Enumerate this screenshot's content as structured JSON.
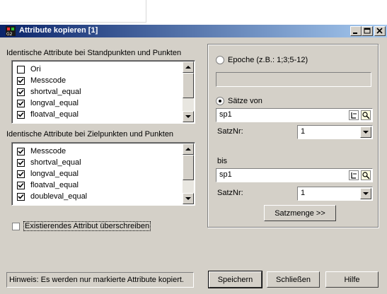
{
  "window": {
    "title": "Attribute kopieren [1]",
    "title_bar_color": "#0a246a"
  },
  "left": {
    "label_standpunkte": "Identische Attribute bei Standpunkten und Punkten",
    "list1": [
      {
        "label": "Ori",
        "checked": false
      },
      {
        "label": "Messcode",
        "checked": true
      },
      {
        "label": "shortval_equal",
        "checked": true
      },
      {
        "label": "longval_equal",
        "checked": true
      },
      {
        "label": "floatval_equal",
        "checked": true
      }
    ],
    "label_zielpunkte": "Identische Attribute bei Zielpunkten und Punkten",
    "list2": [
      {
        "label": "Messcode",
        "checked": true
      },
      {
        "label": "shortval_equal",
        "checked": true
      },
      {
        "label": "longval_equal",
        "checked": true
      },
      {
        "label": "floatval_equal",
        "checked": true
      },
      {
        "label": "doubleval_equal",
        "checked": true
      }
    ],
    "overwrite_label": "Existierendes Attribut überschreiben",
    "overwrite_checked": false
  },
  "right": {
    "epoche_label": "Epoche (z.B.: 1;3;5-12)",
    "epoche_value": "",
    "saetze_label": "Sätze von",
    "von_value": "sp1",
    "satznr_label": "SatzNr:",
    "satznr_von": "1",
    "bis_label": "bis",
    "bis_value": "sp1",
    "satznr_bis": "1",
    "satzmenge_button": "Satzmenge >>"
  },
  "footer": {
    "hint": "Hinweis: Es werden nur markierte Attribute kopiert.",
    "save_button": "Speichern",
    "close_button": "Schließen",
    "help_button": "Hilfe"
  }
}
